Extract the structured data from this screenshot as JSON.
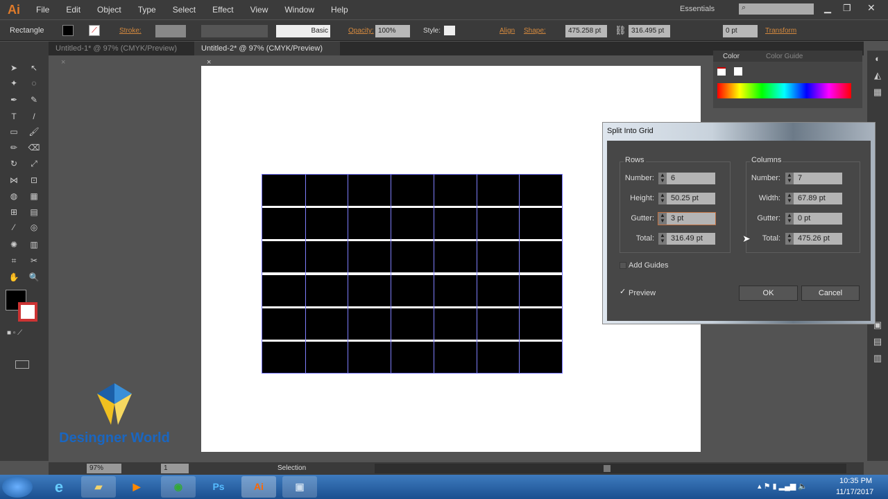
{
  "app": {
    "logo": "Ai",
    "menu": [
      "File",
      "Edit",
      "Object",
      "Type",
      "Select",
      "Effect",
      "View",
      "Window",
      "Help"
    ],
    "workspace": "Essentials"
  },
  "control": {
    "tool_name": "Rectangle",
    "stroke_label": "Stroke:",
    "brush": "Basic",
    "opacity_label": "Opacity:",
    "opacity": "100%",
    "style_label": "Style:",
    "align_label": "Align",
    "shape_label": "Shape:",
    "width": "475.258 pt",
    "height": "316.495 pt",
    "corner": "0 pt",
    "transform_label": "Transform"
  },
  "tabs": [
    {
      "label": "Untitled-1* @ 97% (CMYK/Preview)"
    },
    {
      "label": "Untitled-2* @ 97% (CMYK/Preview)"
    }
  ],
  "panel": {
    "color_tab": "Color",
    "guide_tab": "Color Guide"
  },
  "grid": {
    "rows": 6,
    "columns": 7
  },
  "dialog": {
    "title": "Split Into Grid",
    "rows_title": "Rows",
    "columns_title": "Columns",
    "rows": [
      {
        "label": "Number:",
        "value": "6"
      },
      {
        "label": "Height:",
        "value": "50.25 pt"
      },
      {
        "label": "Gutter:",
        "value": "3 pt"
      },
      {
        "label": "Total:",
        "value": "316.49 pt"
      }
    ],
    "columns": [
      {
        "label": "Number:",
        "value": "7"
      },
      {
        "label": "Width:",
        "value": "67.89 pt"
      },
      {
        "label": "Gutter:",
        "value": "0 pt"
      },
      {
        "label": "Total:",
        "value": "475.26 pt"
      }
    ],
    "add_guides": "Add Guides",
    "preview": "Preview",
    "ok": "OK",
    "cancel": "Cancel"
  },
  "status": {
    "zoom": "97%",
    "page": "1",
    "tool": "Selection"
  },
  "watermark": "Desingner World",
  "taskbar": {
    "apps": [
      "Explorer",
      "Media Player",
      "Chrome",
      "Ps",
      "Ai",
      "Window"
    ],
    "time": "10:35 PM",
    "date": "11/17/2017"
  }
}
